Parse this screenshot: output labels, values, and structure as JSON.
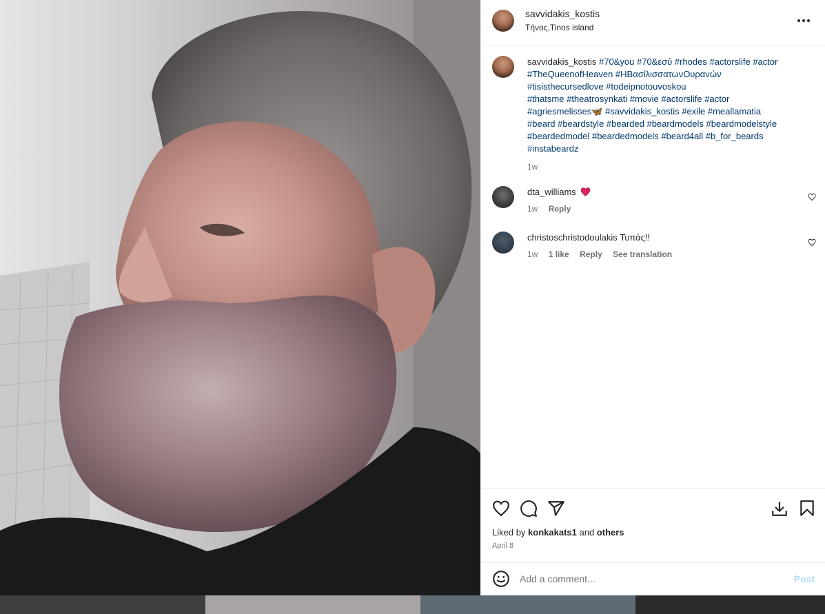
{
  "post": {
    "username": "savvidakis_kostis",
    "location": "Τήνος,Tinos island",
    "caption_author": "savvidakis_kostis",
    "caption_lines": [
      "#70&you #70&εσύ #rhodes #actorslife #actor",
      "#TheQueenofHeaven #ΗΒασίλισσατωνΟυρανών",
      "#tisisthecursedlove #todeipnotouvoskou",
      "#thatsme #theatrosynkati #movie #actorslife #actor",
      "#agriesmelisses🦋 #savvidakis_kostis #exile #meallamatia",
      "#beard #beardstyle #bearded #beardmodels #beardmodelstyle",
      "#beardedmodel #beardedmodels #beard4all #b_for_beards",
      "#instabeardz"
    ],
    "caption_time": "1w"
  },
  "comments": [
    {
      "author": "dta_williams",
      "text": "",
      "time": "1w",
      "reply": "Reply"
    },
    {
      "author": "christoschristodoulakis",
      "text": "Τυπάς!!",
      "time": "1w",
      "likes": "1 like",
      "reply": "Reply",
      "translate": "See translation"
    }
  ],
  "footer": {
    "liked_prefix": "Liked by ",
    "liked_user": "konkakats1",
    "liked_mid": " and ",
    "liked_others": "others",
    "date": "April 8",
    "comment_placeholder": "Add a comment...",
    "post_label": "Post"
  },
  "icons": {
    "more": "more-options-icon",
    "like": "heart-icon",
    "comment": "comment-icon",
    "share": "share-icon",
    "download": "download-icon",
    "save": "bookmark-icon",
    "emoji": "emoji-icon"
  },
  "colors": {
    "hashtag": "#00376b",
    "post_button": "#b3dbff",
    "secondary_text": "#737373"
  }
}
